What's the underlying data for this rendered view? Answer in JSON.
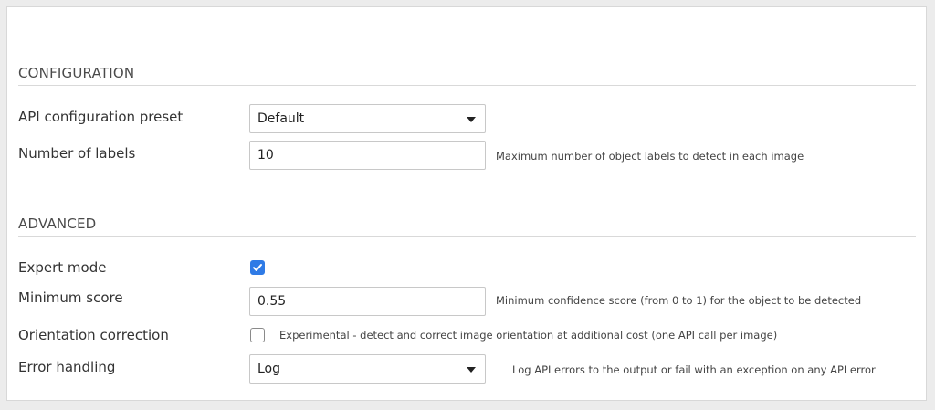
{
  "configuration": {
    "header": "CONFIGURATION",
    "api_preset": {
      "label": "API configuration preset",
      "value": "Default"
    },
    "num_labels": {
      "label": "Number of labels",
      "value": "10",
      "help": "Maximum number of object labels to detect in each image"
    }
  },
  "advanced": {
    "header": "ADVANCED",
    "expert_mode": {
      "label": "Expert mode",
      "checked": true
    },
    "min_score": {
      "label": "Minimum score",
      "value": "0.55",
      "help": "Minimum confidence score (from 0 to 1) for the object to be detected"
    },
    "orientation": {
      "label": "Orientation correction",
      "checked": false,
      "help": "Experimental - detect and correct image orientation at additional cost (one API call per image)"
    },
    "error_handling": {
      "label": "Error handling",
      "value": "Log",
      "help": "Log API errors to the output or fail with an exception on any API error"
    }
  },
  "colors": {
    "checkbox_accent": "#2f7be6",
    "panel_bg": "#ffffff",
    "page_bg": "#ececec"
  }
}
